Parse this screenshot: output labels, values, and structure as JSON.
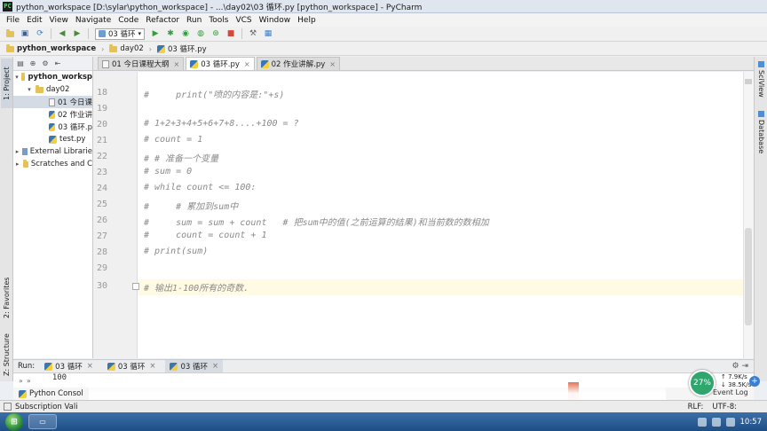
{
  "window": {
    "title": "python_workspace [D:\\sylar\\python_workspace] - ...\\day02\\03 循环.py [python_workspace] - PyCharm"
  },
  "menu": [
    "File",
    "Edit",
    "View",
    "Navigate",
    "Code",
    "Refactor",
    "Run",
    "Tools",
    "VCS",
    "Window",
    "Help"
  ],
  "toolbar": {
    "run_config": "03 循环"
  },
  "breadcrumb": {
    "project": "python_workspace",
    "folder": "day02",
    "file": "03 循环.py"
  },
  "left_stripe": {
    "project": "1: Project",
    "favorites": "2: Favorites",
    "structure": "Z: Structure"
  },
  "right_stripe": {
    "sciview": "SciView",
    "database": "Database"
  },
  "project_tree": {
    "root": "python_worksp",
    "folder": "day02",
    "files": [
      "01 今日课",
      "02 作业讲",
      "03 循环.p",
      "test.py"
    ],
    "external": "External Librarie",
    "scratches": "Scratches and C"
  },
  "editor_tabs": [
    {
      "label": "01 今日课程大纲",
      "active": false
    },
    {
      "label": "03 循环.py",
      "active": true
    },
    {
      "label": "02 作业讲解.py",
      "active": false
    }
  ],
  "editor": {
    "lines": [
      {
        "no": "18",
        "text": "#     print(\"喷的内容是:\"+s)"
      },
      {
        "no": "19",
        "text": ""
      },
      {
        "no": "20",
        "text": "# 1+2+3+4+5+6+7+8....+100 = ?"
      },
      {
        "no": "21",
        "text": "# count = 1"
      },
      {
        "no": "22",
        "text": "# # 准备一个变量"
      },
      {
        "no": "23",
        "text": "# sum = 0"
      },
      {
        "no": "24",
        "text": "# while count <= 100:"
      },
      {
        "no": "25",
        "text": "#     # 累加到sum中"
      },
      {
        "no": "26",
        "text": "#     sum = sum + count   # 把sum中的值(之前运算的结果)和当前数的数相加"
      },
      {
        "no": "27",
        "text": "#     count = count + 1"
      },
      {
        "no": "28",
        "text": "# print(sum)"
      },
      {
        "no": "29",
        "text": ""
      },
      {
        "no": "30",
        "text": "# 输出1-100所有的奇数."
      }
    ]
  },
  "run_panel": {
    "label": "Run:",
    "tabs": [
      {
        "label": "03 循环",
        "active": false
      },
      {
        "label": "03 循环",
        "active": false
      },
      {
        "label": "03 循环",
        "active": true
      }
    ],
    "output": "100",
    "console_tab": "Python Consol"
  },
  "statusbar": {
    "message": "Subscription Vali",
    "line_sep": "RLF:",
    "encoding": "UTF-8:"
  },
  "net_widget": {
    "percent": "27%",
    "up": "7.9K/s",
    "down": "38.5K/s"
  },
  "event_log": "Event Log",
  "taskbar": {
    "clock": "10:57"
  },
  "colors": {
    "accent": "#3a76b3",
    "caret_line": "#fffae3",
    "comment": "#8a8a8a",
    "net": "#2fa66e"
  }
}
